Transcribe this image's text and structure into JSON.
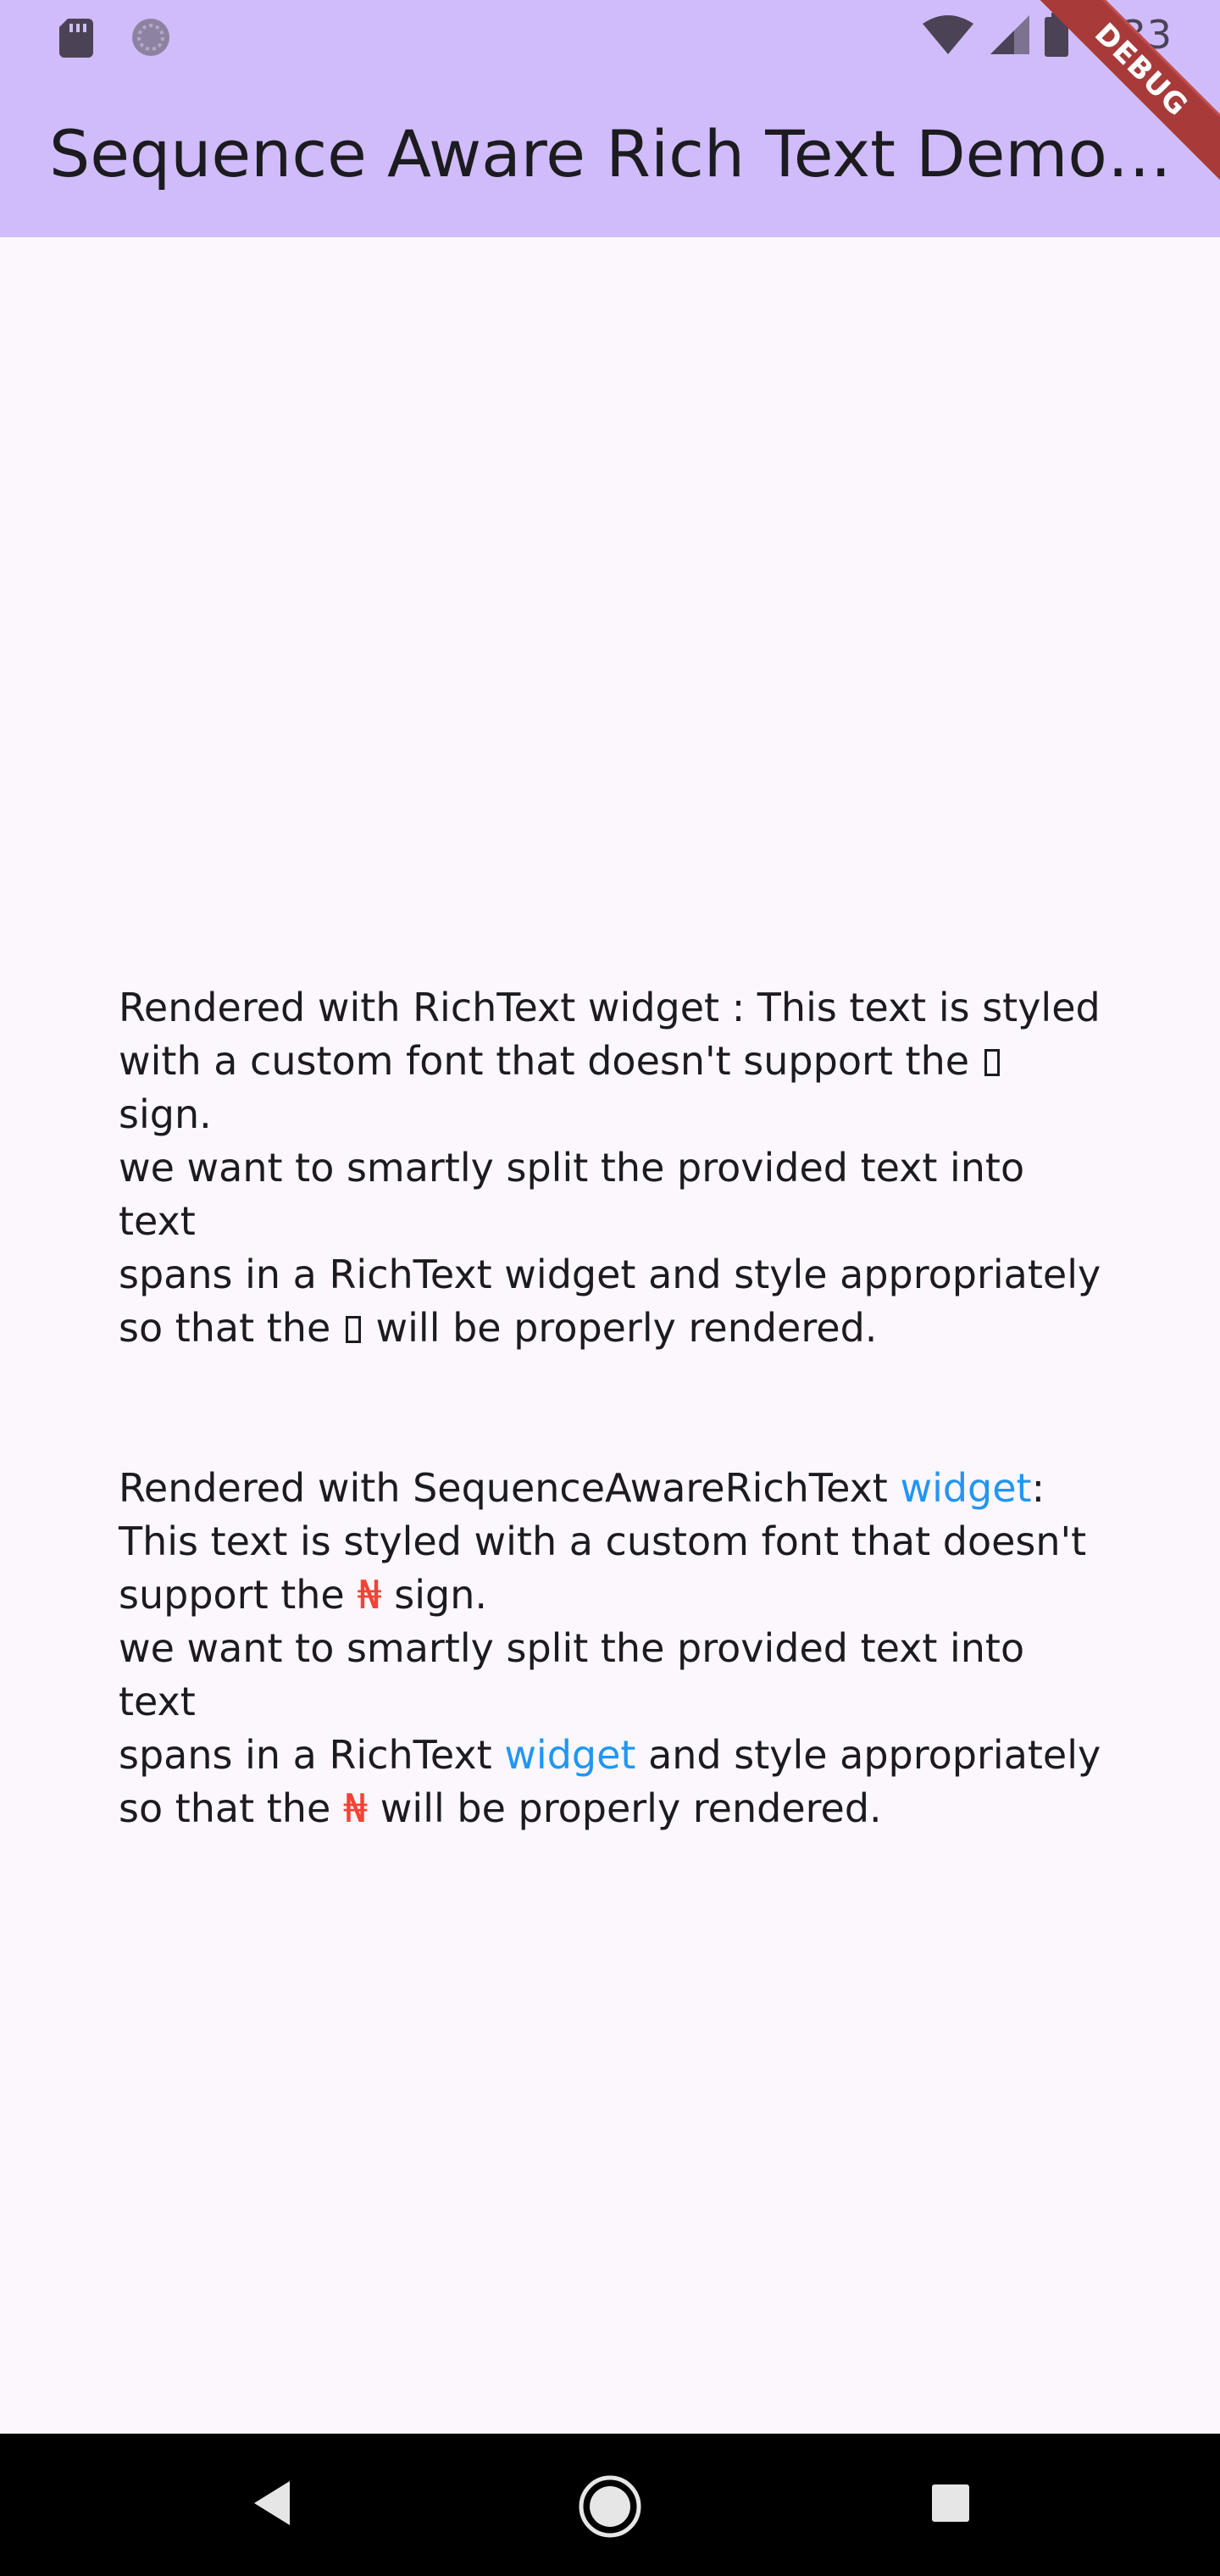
{
  "status_bar": {
    "time": "7:33",
    "left_icons": [
      "sd-card-icon",
      "sync-icon"
    ],
    "right_icons": [
      "wifi-icon",
      "cell-signal-icon",
      "battery-icon"
    ]
  },
  "app_bar": {
    "title": "Sequence Aware Rich Text Demo Ho…",
    "debug_label": "DEBUG",
    "colors": {
      "background": "#d0bcfb",
      "debug_ribbon": "#a83a3a"
    }
  },
  "paragraph_richtext": {
    "line1": "Rendered with RichText widget : This text is styled",
    "line2_a": "with a custom font that doesn't support the",
    "line2_b": "sign.",
    "line3": "we want to smartly split the provided text into text",
    "line4": "spans in a RichText widget and style appropriately",
    "line5_a": "so that the",
    "line5_b": "will be properly rendered."
  },
  "paragraph_sequence": {
    "seg1": "Rendered with SequenceAwareRichText ",
    "widget_word_1": "widget",
    "seg2": ":\nThis text is styled with a custom font that doesn't\nsupport the ",
    "naira_1": "₦",
    "seg3": " sign.\nwe want to smartly split the provided text into text\nspans in a RichText ",
    "widget_word_2": "widget",
    "seg4": " and style appropriately\nso that the ",
    "naira_2": "₦",
    "seg5": " will be properly rendered.",
    "colors": {
      "widget_word": "#2196f3",
      "naira": "#f44336"
    }
  },
  "nav_bar": {
    "buttons": [
      "back-triangle-icon",
      "home-circle-icon",
      "recents-square-icon"
    ]
  }
}
